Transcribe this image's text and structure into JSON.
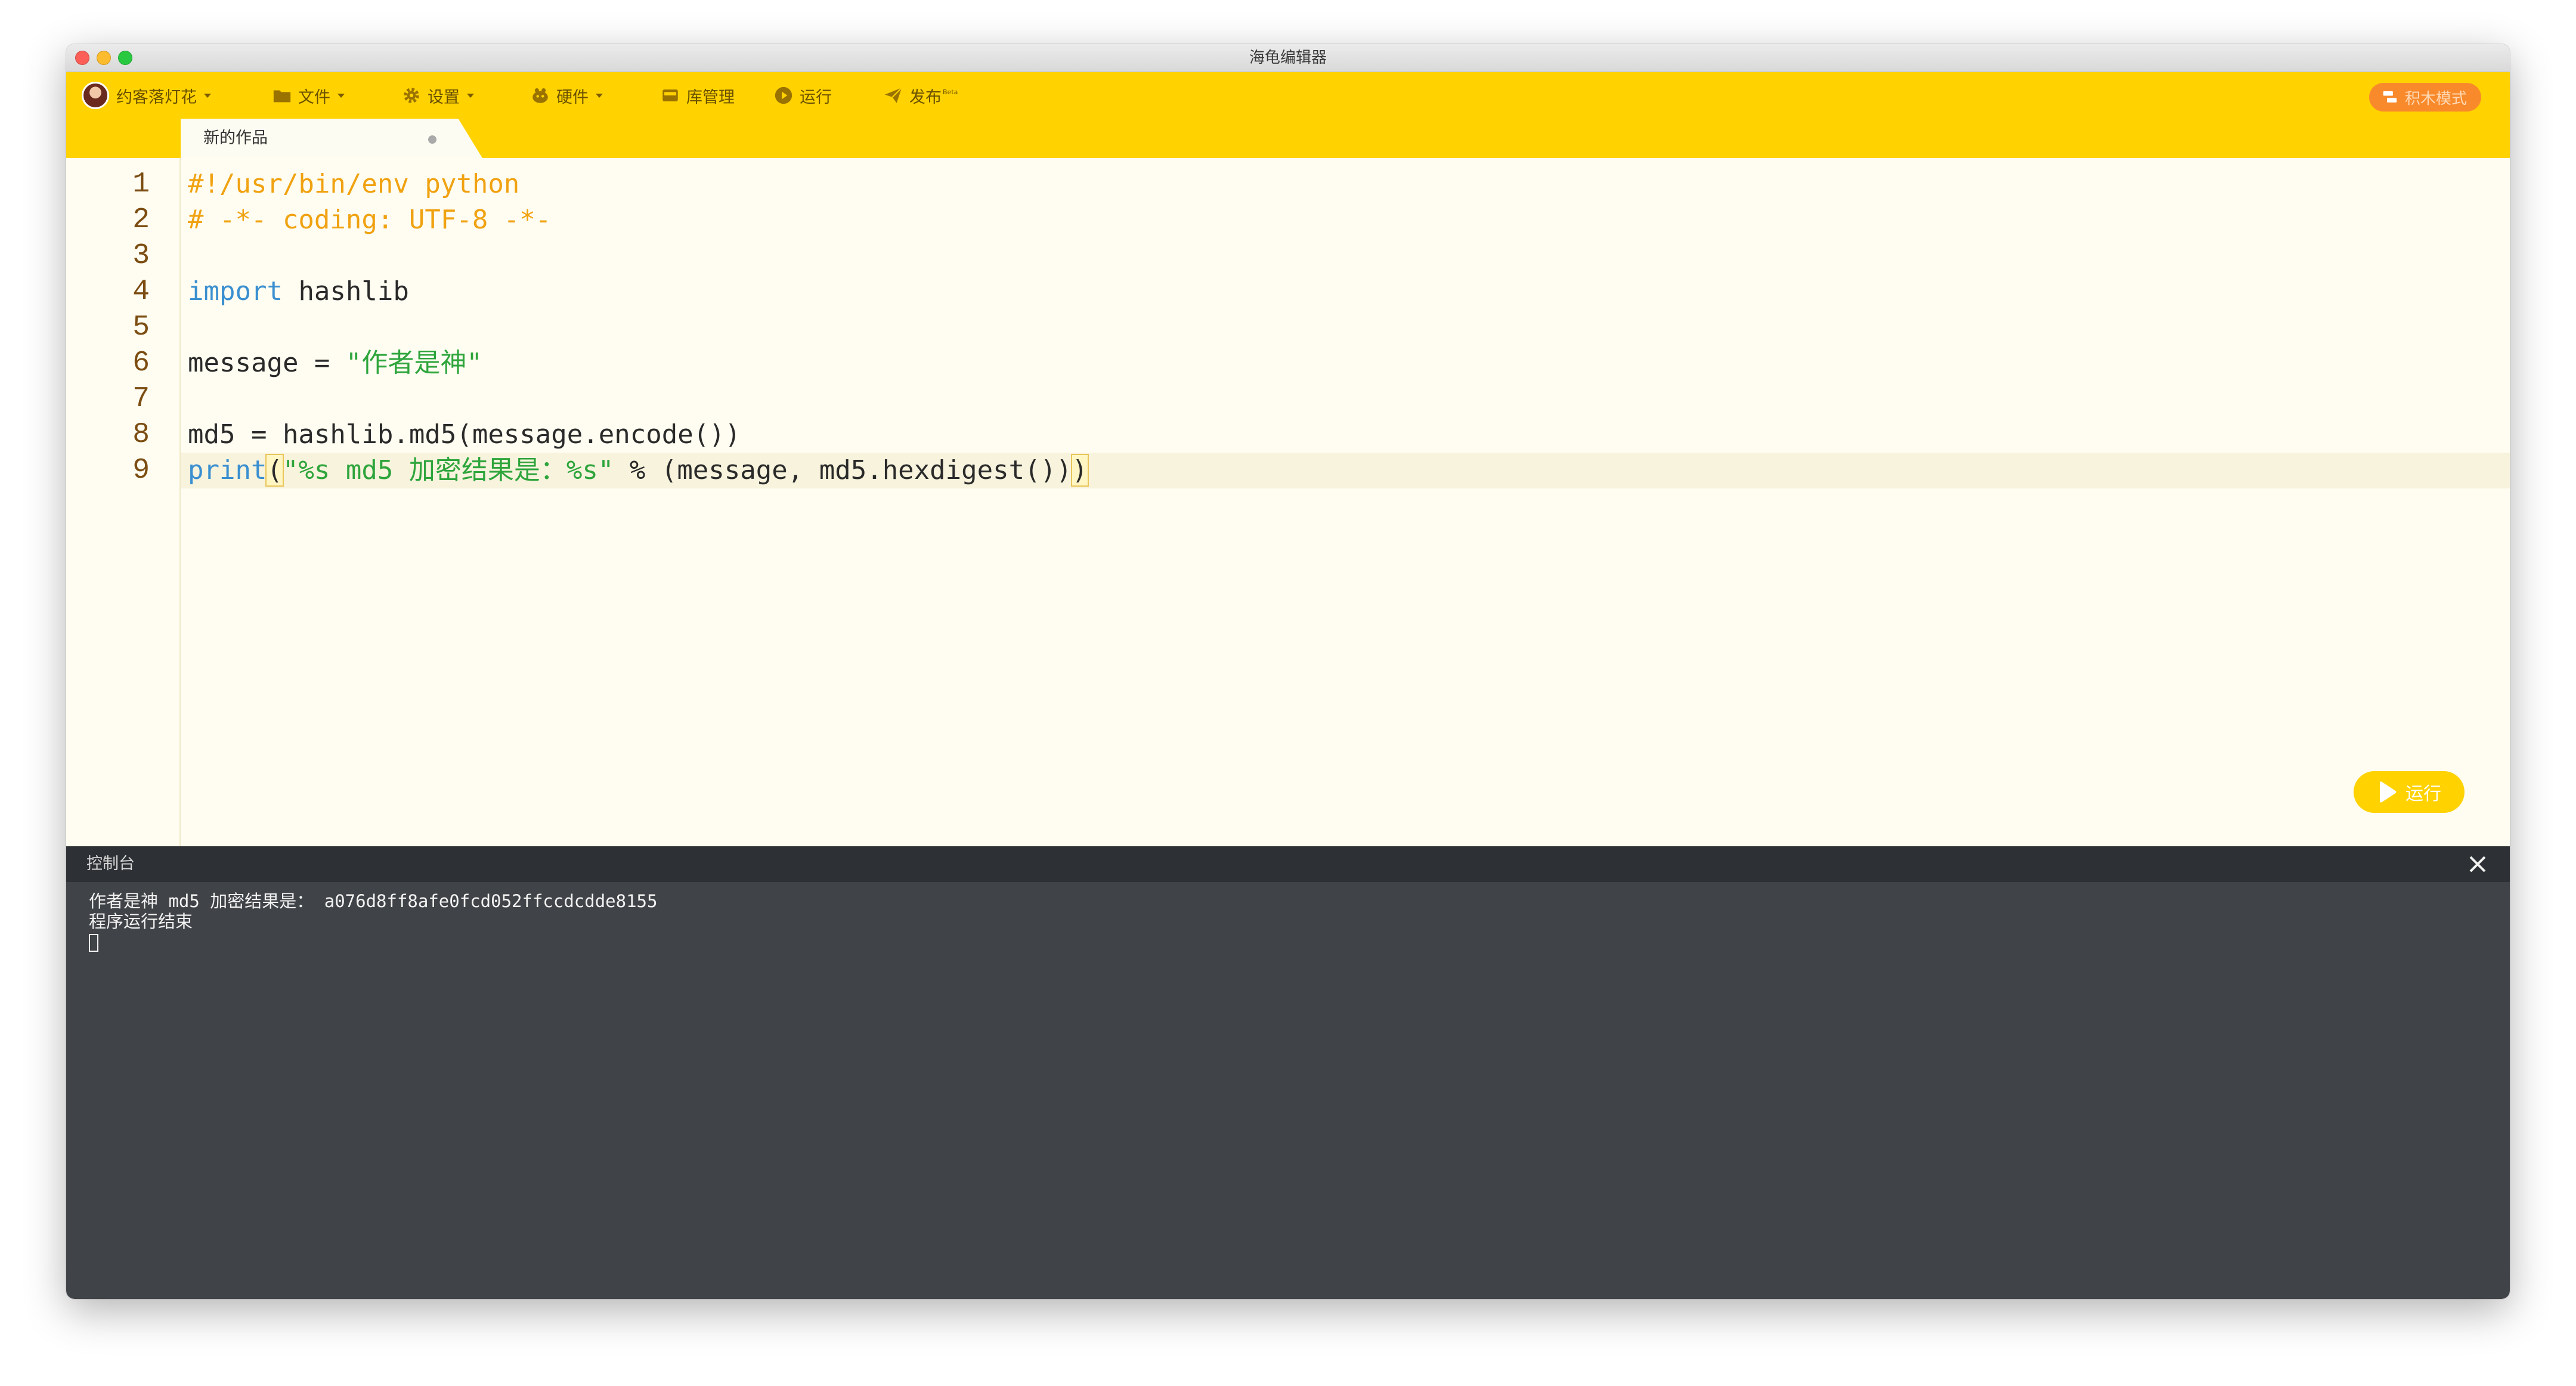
{
  "window": {
    "title": "海龟编辑器"
  },
  "toolbar": {
    "user_name": "约客落灯花",
    "file_label": "文件",
    "settings_label": "设置",
    "hardware_label": "硬件",
    "library_label": "库管理",
    "run_label": "运行",
    "publish_label": "发布",
    "publish_badge": "Beta",
    "mode_label": "积木模式",
    "accent_color": "#ffd200"
  },
  "tabs": [
    {
      "label": "新的作品",
      "modified": true
    }
  ],
  "editor": {
    "line_numbers": [
      "1",
      "2",
      "3",
      "4",
      "5",
      "6",
      "7",
      "8",
      "9"
    ],
    "lines": {
      "l1": "#!/usr/bin/env python",
      "l2": "# -*- coding: UTF-8 -*-",
      "l4_kw": "import",
      "l4_rest": " hashlib",
      "l6_pre": "message = ",
      "l6_str": "\"作者是神\"",
      "l8": "md5 = hashlib.md5(message.encode())",
      "l9_kw": "print",
      "l9_open": "(",
      "l9_str": "\"%s md5 加密结果是：%s\"",
      "l9_rest": " % (message, md5.hexdigest())",
      "l9_close": ")"
    },
    "active_line": 9,
    "run_button_label": "运行"
  },
  "console": {
    "title": "控制台",
    "output_lines": [
      "作者是神 md5 加密结果是： a076d8ff8afe0fcd052ffccdcdde8155",
      "程序运行结束"
    ]
  }
}
